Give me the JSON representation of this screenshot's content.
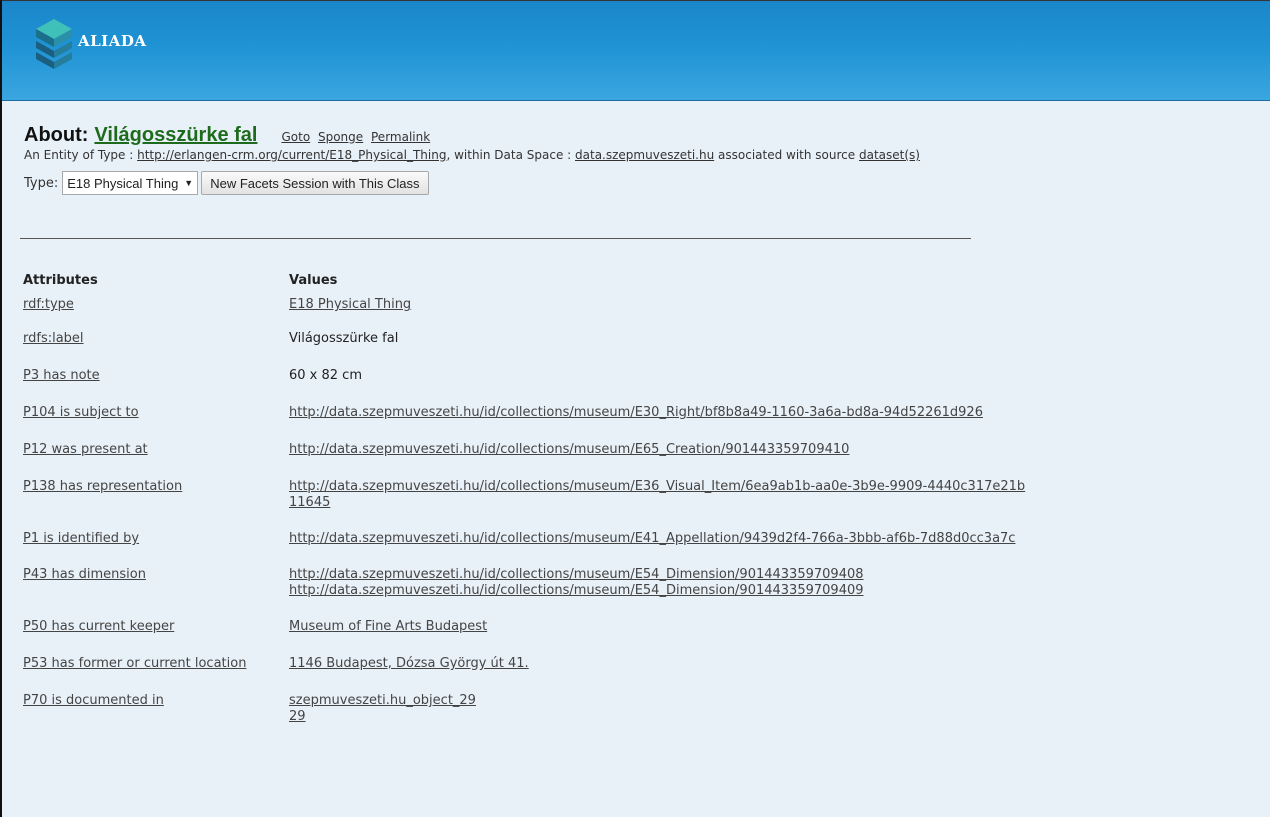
{
  "header": {
    "brand": "ALIADA",
    "bg_color": "#1f93d4"
  },
  "about": {
    "prefix": "About:",
    "title": "Világosszürke fal",
    "links": [
      "Goto",
      "Sponge",
      "Permalink"
    ],
    "entity_prefix": "An Entity of Type :",
    "entity_type_url": "http://erlangen-crm.org/current/E18_Physical_Thing",
    "within_text": ", within Data Space :",
    "data_space": "data.szepmuveszeti.hu",
    "associated_text": "associated with source",
    "dataset_link": "dataset(s)"
  },
  "type_bar": {
    "label": "Type:",
    "selected": "E18 Physical Thing",
    "button": "New Facets Session with This Class"
  },
  "table": {
    "col_attributes": "Attributes",
    "col_values": "Values",
    "rows": [
      {
        "attr": "rdf:type",
        "values": [
          "E18 Physical Thing"
        ]
      },
      {
        "attr": "rdfs:label",
        "values": [
          "Világosszürke fal"
        ]
      },
      {
        "attr": "P3 has note",
        "values": [
          "60 x 82 cm"
        ]
      },
      {
        "attr": "P104 is subject to",
        "values": [
          "http://data.szepmuveszeti.hu/id/collections/museum/E30_Right/bf8b8a49-1160-3a6a-bd8a-94d52261d926"
        ]
      },
      {
        "attr": "P12 was present at",
        "values": [
          "http://data.szepmuveszeti.hu/id/collections/museum/E65_Creation/901443359709410"
        ]
      },
      {
        "attr": "P138 has representation",
        "values": [
          "http://data.szepmuveszeti.hu/id/collections/museum/E36_Visual_Item/6ea9ab1b-aa0e-3b9e-9909-4440c317e21b",
          "11645"
        ]
      },
      {
        "attr": "P1 is identified by",
        "values": [
          "http://data.szepmuveszeti.hu/id/collections/museum/E41_Appellation/9439d2f4-766a-3bbb-af6b-7d88d0cc3a7c"
        ]
      },
      {
        "attr": "P43 has dimension",
        "values": [
          "http://data.szepmuveszeti.hu/id/collections/museum/E54_Dimension/901443359709408",
          "http://data.szepmuveszeti.hu/id/collections/museum/E54_Dimension/901443359709409"
        ]
      },
      {
        "attr": "P50 has current keeper",
        "values": [
          "Museum of Fine Arts Budapest"
        ]
      },
      {
        "attr": "P53 has former or current location",
        "values": [
          "1146 Budapest, Dózsa György út 41."
        ]
      },
      {
        "attr": "P70 is documented in",
        "values": [
          "szepmuveszeti.hu_object_29",
          "29"
        ]
      }
    ]
  }
}
